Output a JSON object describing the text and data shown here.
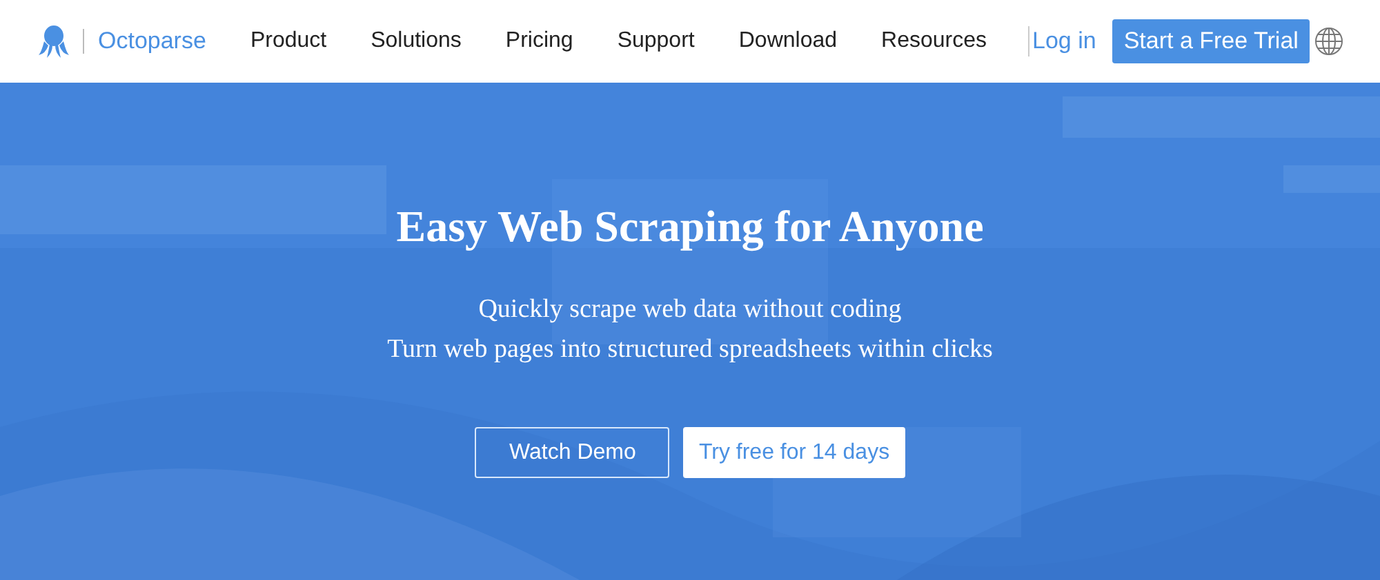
{
  "header": {
    "brand": "Octoparse",
    "nav": [
      "Product",
      "Solutions",
      "Pricing",
      "Support",
      "Download",
      "Resources"
    ],
    "login": "Log in",
    "cta": "Start a Free Trial"
  },
  "hero": {
    "kind": "picture",
    "title": "Easy Web Scraping for Anyone",
    "subtitle_lines": [
      "Quickly scrape web data without coding",
      "Turn web pages into structured spreadsheets within clicks"
    ],
    "buttons": [
      {
        "label": "Watch Demo",
        "kind": "outline"
      },
      {
        "label": "Try free for 14 days",
        "kind": "solid"
      }
    ]
  }
}
